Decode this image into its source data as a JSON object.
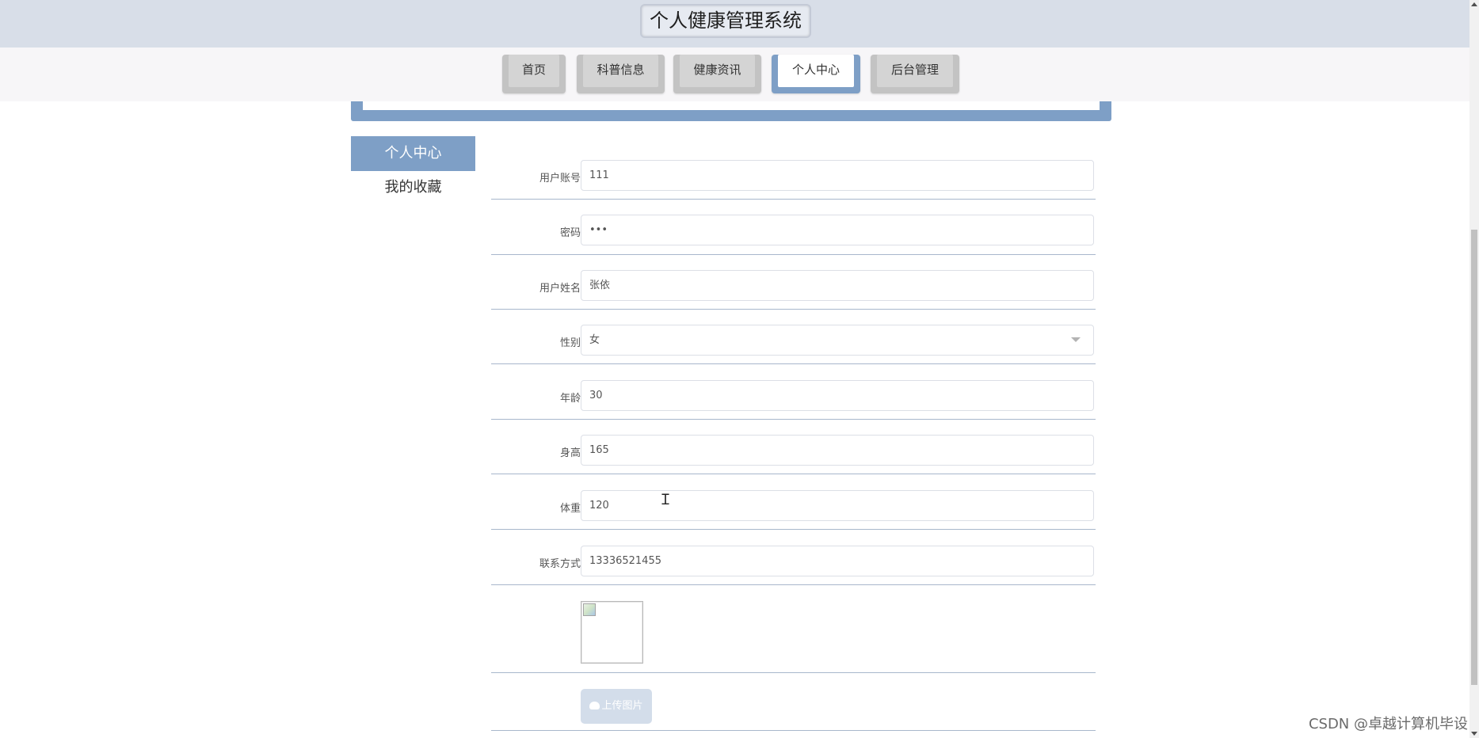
{
  "header": {
    "title": "个人健康管理系统"
  },
  "nav": {
    "items": [
      {
        "label": "首页"
      },
      {
        "label": "科普信息"
      },
      {
        "label": "健康资讯"
      },
      {
        "label": "个人中心",
        "active": true
      },
      {
        "label": "后台管理"
      }
    ]
  },
  "sidebar": {
    "items": [
      {
        "label": "个人中心",
        "active": true
      },
      {
        "label": "我的收藏"
      }
    ]
  },
  "form": {
    "fields": [
      {
        "label": "用户账号",
        "value": "111"
      },
      {
        "label": "密码",
        "value": "•••"
      },
      {
        "label": "用户姓名",
        "value": "张依"
      },
      {
        "label": "性别",
        "value": "女"
      },
      {
        "label": "年龄",
        "value": "30"
      },
      {
        "label": "身高",
        "value": "165"
      },
      {
        "label": "体重",
        "value": "120"
      },
      {
        "label": "联系方式",
        "value": "13336521455"
      }
    ],
    "upload_label": "上传图片"
  },
  "watermark": "CSDN @卓越计算机毕设",
  "colors": {
    "accent": "#7e9fc6",
    "header_bg": "#d8dee8",
    "tab_bg": "#c3c3c3"
  },
  "icons": {
    "select": "chevron-down-icon",
    "upload": "cloud-upload-icon",
    "image": "broken-image-icon"
  }
}
